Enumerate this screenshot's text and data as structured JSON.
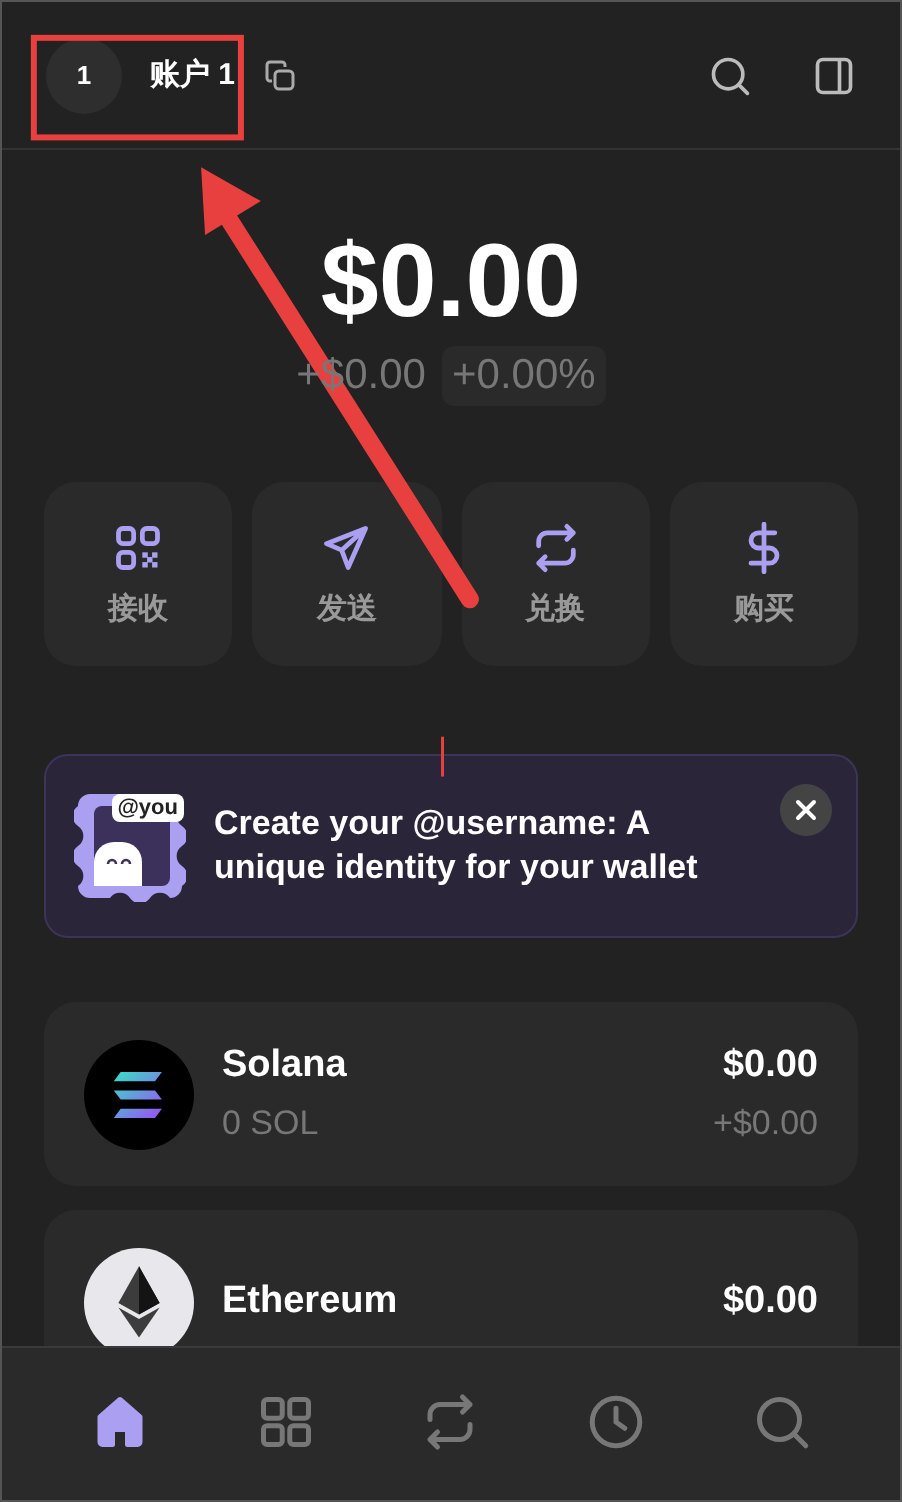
{
  "header": {
    "avatar": "1",
    "account": "账户 1"
  },
  "balance": {
    "total": "$0.00",
    "change": "+$0.00",
    "percent": "+0.00%"
  },
  "actions": [
    {
      "kind": "receive",
      "label": "接收"
    },
    {
      "kind": "send",
      "label": "发送"
    },
    {
      "kind": "swap",
      "label": "兑换"
    },
    {
      "kind": "buy",
      "label": "购买"
    }
  ],
  "banner": {
    "badge": "@you",
    "text": "Create your @username: A unique identity for your wallet"
  },
  "tokens": [
    {
      "kind": "solana",
      "name": "Solana",
      "amount": "0 SOL",
      "value": "$0.00",
      "change": "+$0.00"
    },
    {
      "kind": "ethereum",
      "name": "Ethereum",
      "value": "$0.00"
    }
  ],
  "nav": [
    {
      "kind": "home",
      "selected": true
    },
    {
      "kind": "grid",
      "selected": false
    },
    {
      "kind": "swap",
      "selected": false
    },
    {
      "kind": "history",
      "selected": false
    },
    {
      "kind": "search",
      "selected": false
    }
  ]
}
